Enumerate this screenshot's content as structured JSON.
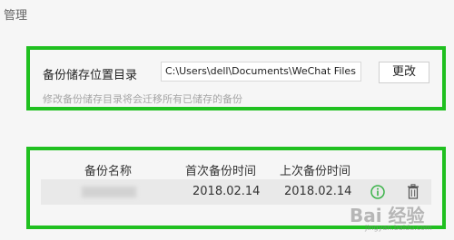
{
  "section": {
    "title": "管理"
  },
  "storage": {
    "label": "备份储存位置目录",
    "path_value": "C:\\Users\\dell\\Documents\\WeChat Files",
    "change_button": "更改",
    "hint": "修改备份储存目录将会迁移所有已储存的备份"
  },
  "backups": {
    "columns": [
      "备份名称",
      "首次备份时间",
      "上次备份时间"
    ],
    "rows": [
      {
        "first_time": "2018.02.14",
        "last_time": "2018.02.14"
      }
    ]
  },
  "colors": {
    "highlight": "#20c020",
    "info": "#3cb34a"
  },
  "icons": [
    "info-icon",
    "trash-icon"
  ],
  "watermark": {
    "text": "Bai 经验",
    "sub": "jingyan.baidu.com"
  }
}
